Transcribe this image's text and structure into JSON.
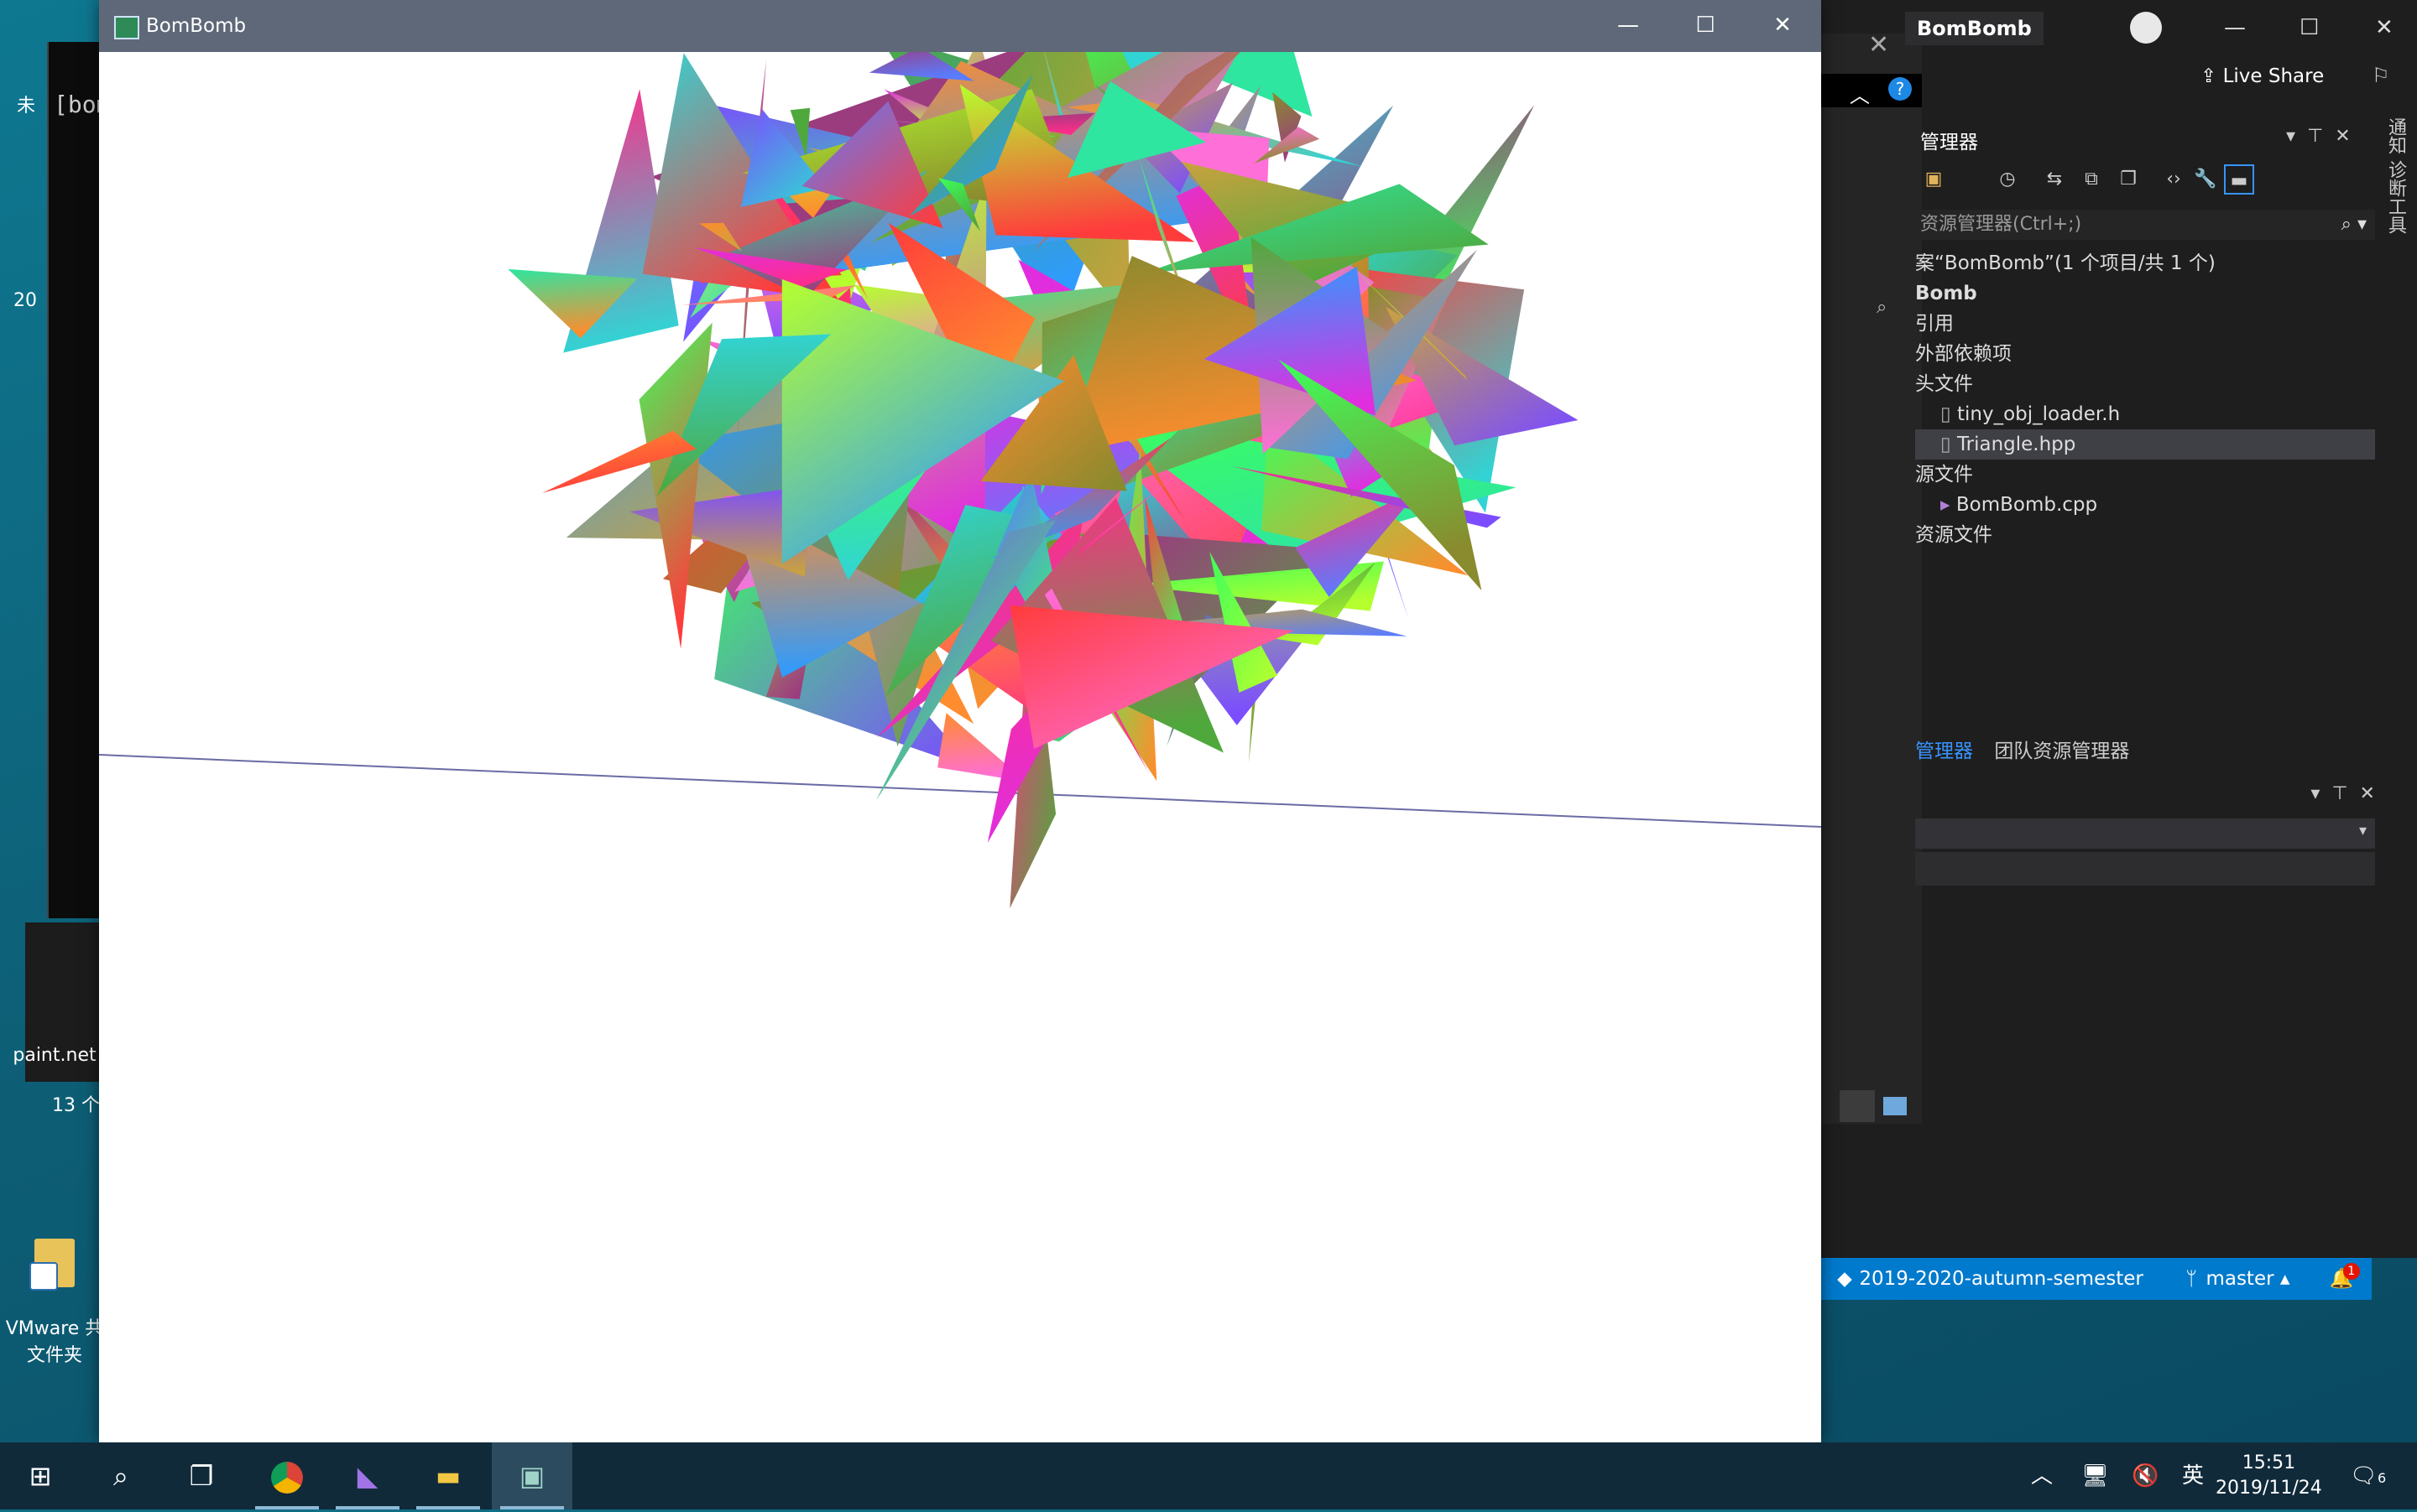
{
  "desktop": {
    "icons": [
      {
        "label": "paint.net"
      },
      {
        "label": "VMware 共\n文件夹"
      }
    ],
    "left_fragments": [
      "未",
      "20",
      "13 个"
    ]
  },
  "console": {
    "text": "[bom"
  },
  "main_window": {
    "title": "BomBomb",
    "controls": {
      "minimize": "—",
      "maximize": "☐",
      "close": "✕"
    }
  },
  "scene": {
    "horizon_color": "#6b6ba6",
    "triangle_colors": [
      "#ff2d8a",
      "#2ee6a0",
      "#7b4dff",
      "#b5ff2e",
      "#ff8c2e",
      "#2e9bff",
      "#e02edf",
      "#3cff5a",
      "#ff3c3c",
      "#31d4d4",
      "#c9a23f",
      "#9b3c7f",
      "#5a7cff",
      "#4fa83c",
      "#ff6fd8",
      "#8a8a2e"
    ]
  },
  "vs": {
    "title": "BomBomb",
    "live_share": "Live Share",
    "solution_explorer_title": "管理器",
    "search_placeholder": "资源管理器(Ctrl+;)",
    "tree": [
      {
        "label": "案“BomBomb”(1 个项目/共 1 个)"
      },
      {
        "label": "Bomb"
      },
      {
        "label": "引用"
      },
      {
        "label": "外部依赖项"
      },
      {
        "label": "头文件"
      },
      {
        "label": "tiny_obj_loader.h"
      },
      {
        "label": "Triangle.hpp"
      },
      {
        "label": "源文件"
      },
      {
        "label": "BomBomb.cpp"
      },
      {
        "label": "资源文件"
      }
    ],
    "bottom_tabs": [
      {
        "label": "管理器"
      },
      {
        "label": "团队资源管理器"
      }
    ],
    "side_labels": "通知 诊断工具",
    "statusbar": {
      "repo": "2019-2020-autumn-semester",
      "branch": "master",
      "notifications": "1"
    }
  },
  "taskbar": {
    "apps": [
      "start",
      "search",
      "task-view",
      "chrome",
      "visual-studio",
      "file-explorer",
      "bombomb"
    ],
    "ime": "英",
    "time": "15:51",
    "date": "2019/11/24",
    "notification_count": "6"
  }
}
